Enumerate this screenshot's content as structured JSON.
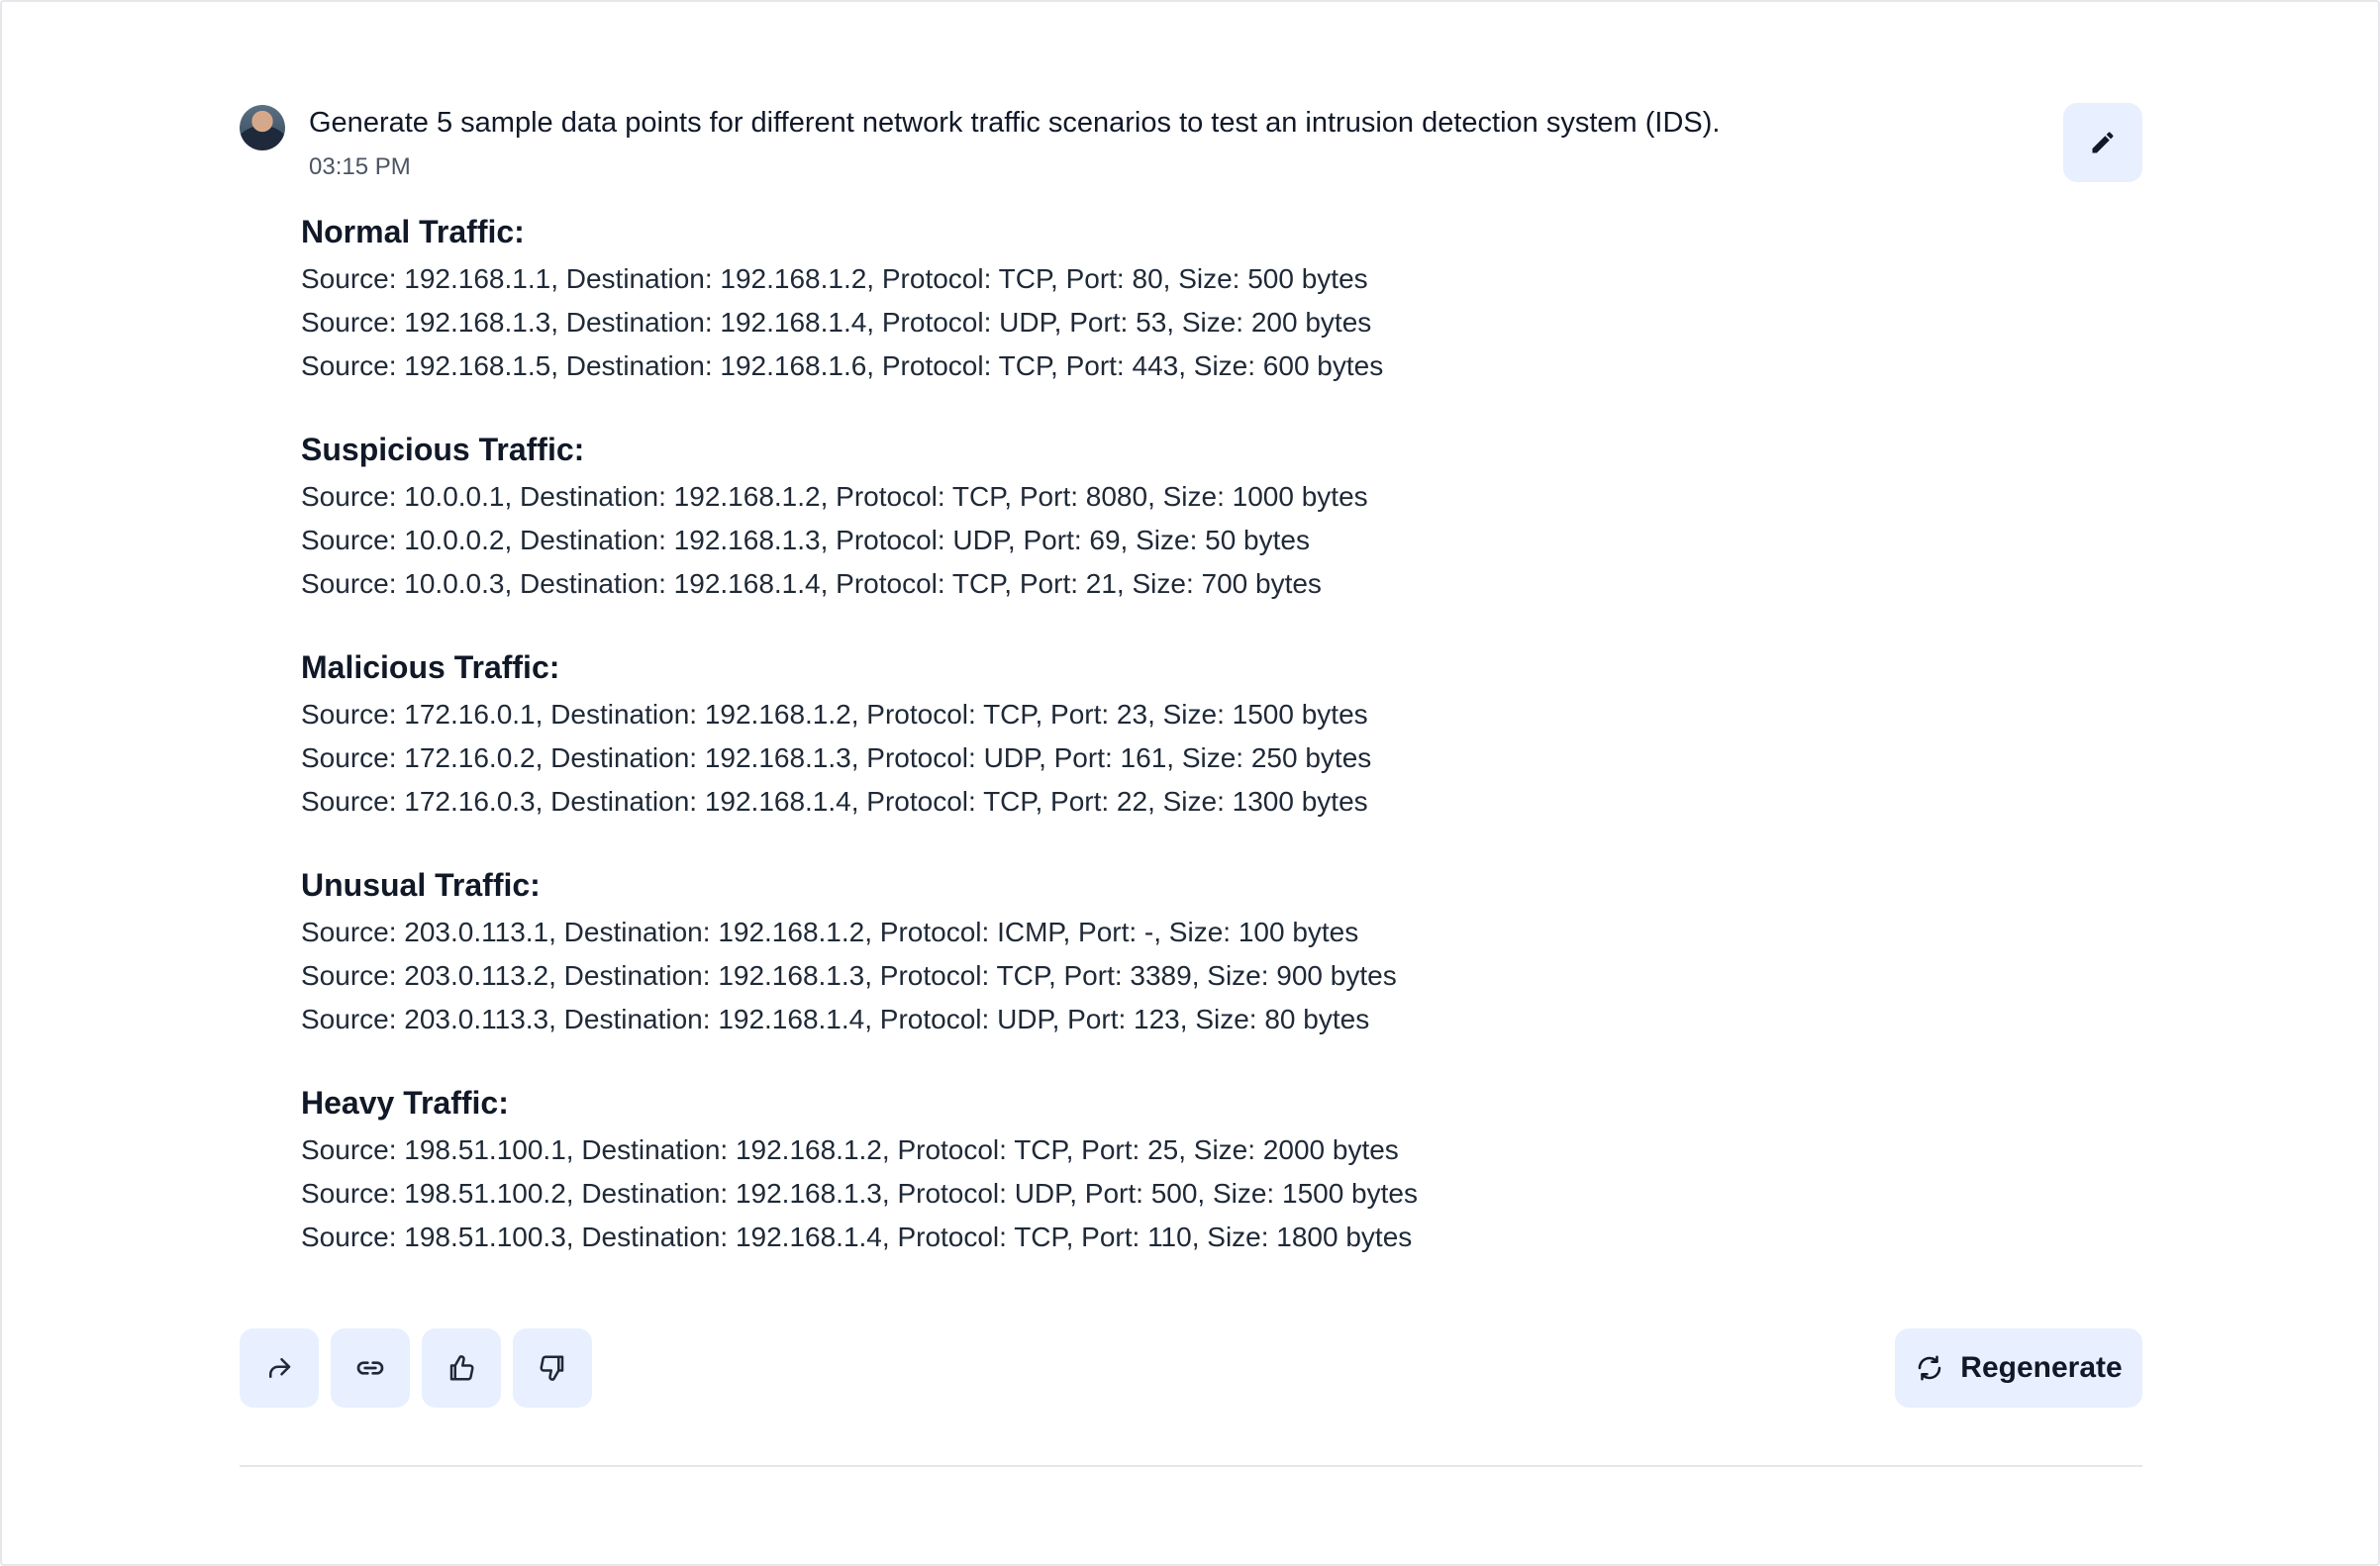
{
  "prompt": {
    "text": "Generate 5 sample data points for different network traffic scenarios to test an intrusion detection system (IDS).",
    "time": "03:15 PM"
  },
  "answer": {
    "sections": [
      {
        "title": "Normal Traffic:",
        "lines": [
          "Source: 192.168.1.1, Destination: 192.168.1.2, Protocol: TCP, Port: 80, Size: 500 bytes",
          "Source: 192.168.1.3, Destination: 192.168.1.4, Protocol: UDP, Port: 53, Size: 200 bytes",
          "Source: 192.168.1.5, Destination: 192.168.1.6, Protocol: TCP, Port: 443, Size: 600 bytes"
        ]
      },
      {
        "title": "Suspicious Traffic:",
        "lines": [
          "Source: 10.0.0.1, Destination: 192.168.1.2, Protocol: TCP, Port: 8080, Size: 1000 bytes",
          "Source: 10.0.0.2, Destination: 192.168.1.3, Protocol: UDP, Port: 69, Size: 50 bytes",
          "Source: 10.0.0.3, Destination: 192.168.1.4, Protocol: TCP, Port: 21, Size: 700 bytes"
        ]
      },
      {
        "title": "Malicious Traffic:",
        "lines": [
          "Source: 172.16.0.1, Destination: 192.168.1.2, Protocol: TCP, Port: 23, Size: 1500 bytes",
          "Source: 172.16.0.2, Destination: 192.168.1.3, Protocol: UDP, Port: 161, Size: 250 bytes",
          "Source: 172.16.0.3, Destination: 192.168.1.4, Protocol: TCP, Port: 22, Size: 1300 bytes"
        ]
      },
      {
        "title": "Unusual Traffic:",
        "lines": [
          "Source: 203.0.113.1, Destination: 192.168.1.2, Protocol: ICMP, Port: -, Size: 100 bytes",
          "Source: 203.0.113.2, Destination: 192.168.1.3, Protocol: TCP, Port: 3389, Size: 900 bytes",
          "Source: 203.0.113.3, Destination: 192.168.1.4, Protocol: UDP, Port: 123, Size: 80 bytes"
        ]
      },
      {
        "title": "Heavy Traffic:",
        "lines": [
          "Source: 198.51.100.1, Destination: 192.168.1.2, Protocol: TCP, Port: 25, Size: 2000 bytes",
          "Source: 198.51.100.2, Destination: 192.168.1.3, Protocol: UDP, Port: 500, Size: 1500 bytes",
          "Source: 198.51.100.3, Destination: 192.168.1.4, Protocol: TCP, Port: 110, Size: 1800 bytes"
        ]
      }
    ]
  },
  "actions": {
    "regenerate_label": "Regenerate",
    "icons": [
      "share-icon",
      "link-icon",
      "thumbs-up-icon",
      "thumbs-down-icon",
      "refresh-icon",
      "pencil-icon"
    ]
  },
  "colors": {
    "button_bg": "#e8efff",
    "text": "#111827",
    "muted": "#4b5563",
    "divider": "#e5e7eb"
  }
}
